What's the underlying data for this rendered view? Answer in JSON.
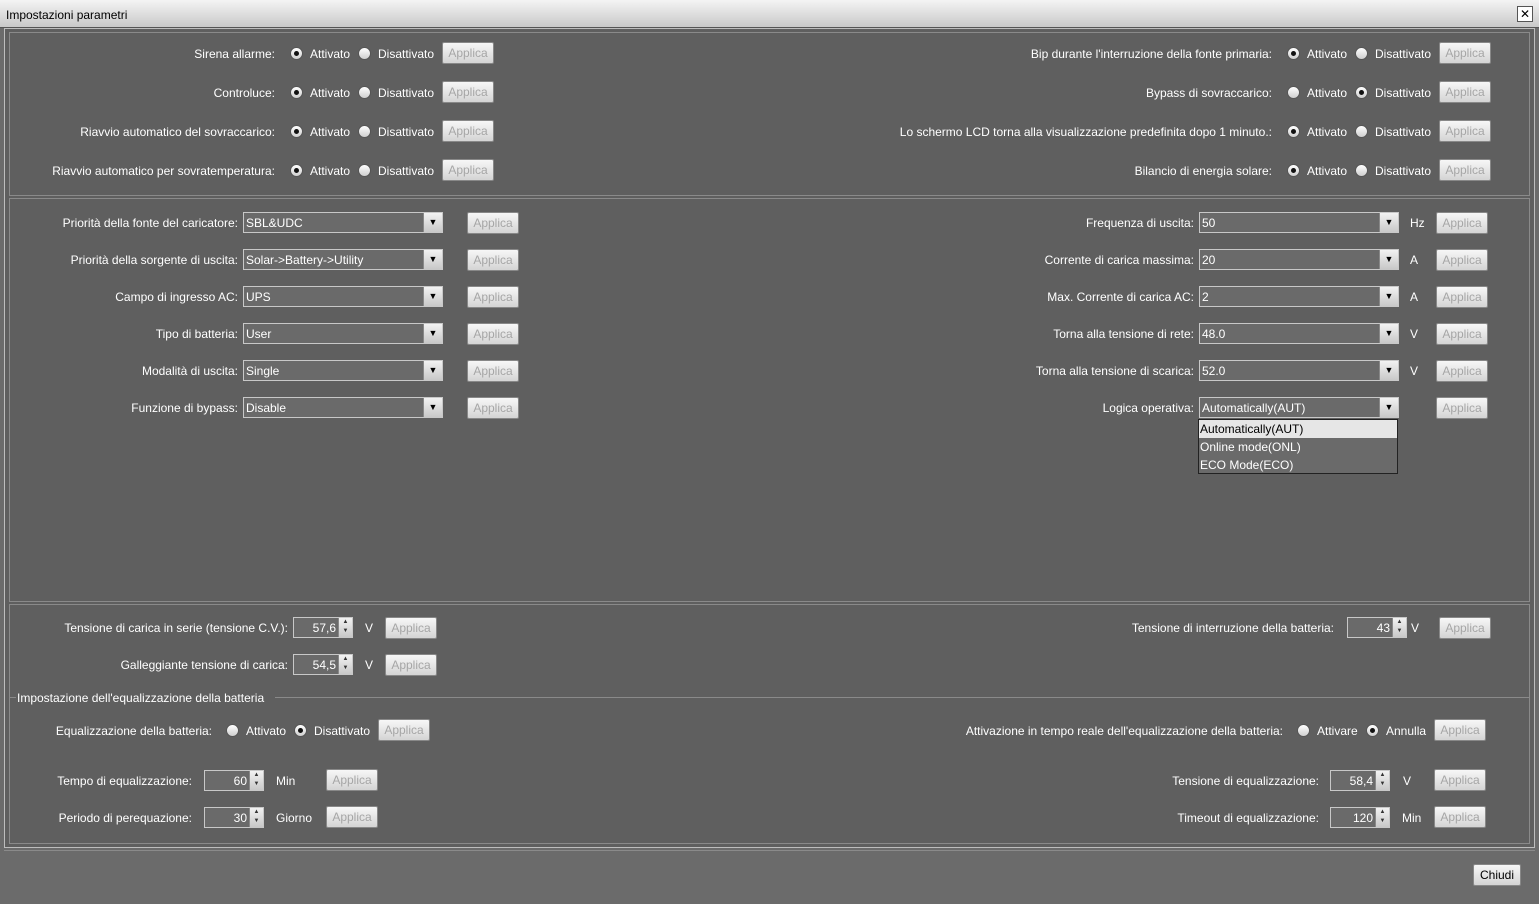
{
  "window": {
    "title": "Impostazioni parametri",
    "close_glyph": "✕"
  },
  "radio": {
    "on": "Attivato",
    "off": "Disattivato",
    "apply": "Applica"
  },
  "section1_left": [
    {
      "label": "Sirena allarme:",
      "activated": true
    },
    {
      "label": "Controluce:",
      "activated": true
    },
    {
      "label": "Riavvio automatico del sovraccarico:",
      "activated": true
    },
    {
      "label": "Riavvio automatico per sovratemperatura:",
      "activated": true
    }
  ],
  "section1_right": [
    {
      "label": "Bip durante l'interruzione della fonte primaria:",
      "activated": true
    },
    {
      "label": "Bypass di sovraccarico:",
      "activated": false
    },
    {
      "label": "Lo schermo LCD torna alla visualizzazione predefinita dopo 1 minuto.:",
      "activated": true
    },
    {
      "label": "Bilancio di energia solare:",
      "activated": true
    }
  ],
  "section2_left": [
    {
      "label": "Priorità della fonte del caricatore:",
      "value": "SBL&UDC"
    },
    {
      "label": "Priorità della sorgente di uscita:",
      "value": "Solar->Battery->Utility"
    },
    {
      "label": "Campo di ingresso AC:",
      "value": "UPS"
    },
    {
      "label": "Tipo di batteria:",
      "value": "User"
    },
    {
      "label": "Modalità di uscita:",
      "value": "Single"
    },
    {
      "label": "Funzione di bypass:",
      "value": "Disable"
    }
  ],
  "section2_right": [
    {
      "label": "Frequenza di uscita:",
      "value": "50",
      "unit": "Hz"
    },
    {
      "label": "Corrente di carica massima:",
      "value": "20",
      "unit": "A"
    },
    {
      "label": "Max. Corrente di carica AC:",
      "value": "2",
      "unit": "A"
    },
    {
      "label": "Torna alla tensione di rete:",
      "value": "48.0",
      "unit": "V"
    },
    {
      "label": "Torna alla tensione di scarica:",
      "value": "52.0",
      "unit": "V"
    },
    {
      "label": "Logica operativa:",
      "value": "Automatically(AUT)",
      "unit": ""
    }
  ],
  "operating_logic_options": [
    "Automatically(AUT)",
    "Online mode(ONL)",
    "ECO Mode(ECO)"
  ],
  "section3": {
    "cv_voltage": {
      "label": "Tensione di carica in serie (tensione C.V.):",
      "value": "57,6",
      "unit": "V"
    },
    "float_voltage": {
      "label": "Galleggiante tensione di carica:",
      "value": "54,5",
      "unit": "V"
    },
    "cutoff_voltage": {
      "label": "Tensione di interruzione della batteria:",
      "value": "43",
      "unit": "V"
    }
  },
  "equalization": {
    "group_title": "Impostazione dell'equalizzazione della batteria",
    "enable": {
      "label": "Equalizzazione della batteria:",
      "activated": false
    },
    "realtime": {
      "label": "Attivazione in tempo reale dell'equalizzazione della batteria:",
      "on": "Attivare",
      "off": "Annulla",
      "activated": false
    },
    "time": {
      "label": "Tempo di equalizzazione:",
      "value": "60",
      "unit": "Min"
    },
    "period": {
      "label": "Periodo di perequazione:",
      "value": "30",
      "unit": "Giorno"
    },
    "voltage": {
      "label": "Tensione di equalizzazione:",
      "value": "58,4",
      "unit": "V"
    },
    "timeout": {
      "label": "Timeout di equalizzazione:",
      "value": "120",
      "unit": "Min"
    }
  },
  "footer": {
    "close_label": "Chiudi"
  },
  "icons": {
    "combo_arrow": "▼",
    "spin_up": "▲",
    "spin_down": "▼"
  }
}
